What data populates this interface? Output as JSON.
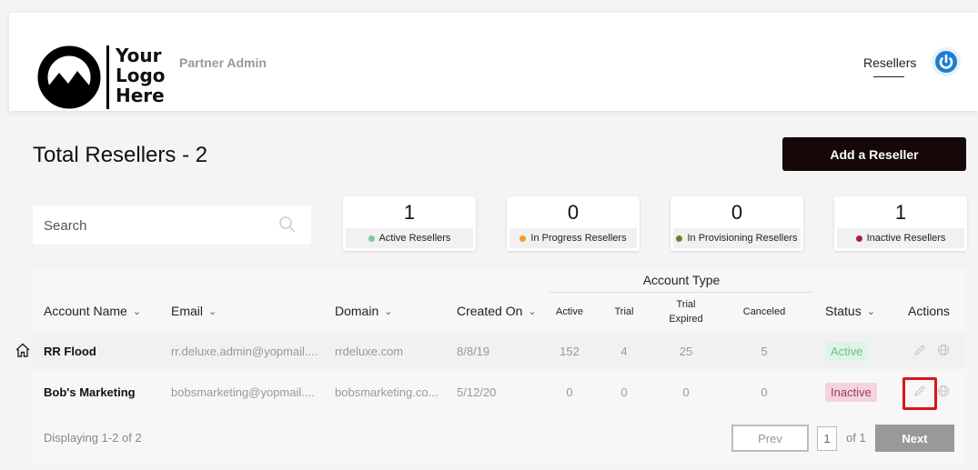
{
  "header": {
    "logo_lines": [
      "Your",
      "Logo",
      "Here"
    ],
    "app_name": "Partner Admin",
    "nav_resellers": "Resellers",
    "power_icon": "power-icon"
  },
  "page": {
    "title": "Total Resellers - 2",
    "add_button": "Add a Reseller"
  },
  "search": {
    "placeholder": "Search",
    "value": ""
  },
  "stats": [
    {
      "value": "1",
      "label": "Active Resellers",
      "color": "#7ccf99"
    },
    {
      "value": "0",
      "label": "In Progress Resellers",
      "color": "#f39a2d"
    },
    {
      "value": "0",
      "label": "In Provisioning Resellers",
      "color": "#7a7a2a"
    },
    {
      "value": "1",
      "label": "Inactive Resellers",
      "color": "#a3204a"
    }
  ],
  "table": {
    "account_type_header": "Account Type",
    "columns": {
      "account_name": "Account Name",
      "email": "Email",
      "domain": "Domain",
      "created_on": "Created On",
      "active": "Active",
      "trial": "Trial",
      "trial_expired": "Trial Expired",
      "canceled": "Canceled",
      "status": "Status",
      "actions": "Actions"
    },
    "rows": [
      {
        "name": "RR Flood",
        "email": "rr.deluxe.admin@yopmail....",
        "domain": "rrdeluxe.com",
        "created": "8/8/19",
        "active": "152",
        "trial": "4",
        "trial_expired": "25",
        "canceled": "5",
        "status": "Active"
      },
      {
        "name": "Bob's Marketing",
        "email": "bobsmarketing@yopmail....",
        "domain": "bobsmarketing.co...",
        "created": "5/12/20",
        "active": "0",
        "trial": "0",
        "trial_expired": "0",
        "canceled": "0",
        "status": "Inactive"
      }
    ]
  },
  "pagination": {
    "summary": "Displaying 1-2 of 2",
    "prev": "Prev",
    "page": "1",
    "of": "of 1",
    "next": "Next"
  },
  "colors": {
    "primary_button": "#160808",
    "highlight": "#d8161b",
    "power_blue": "#1a7fd0"
  }
}
